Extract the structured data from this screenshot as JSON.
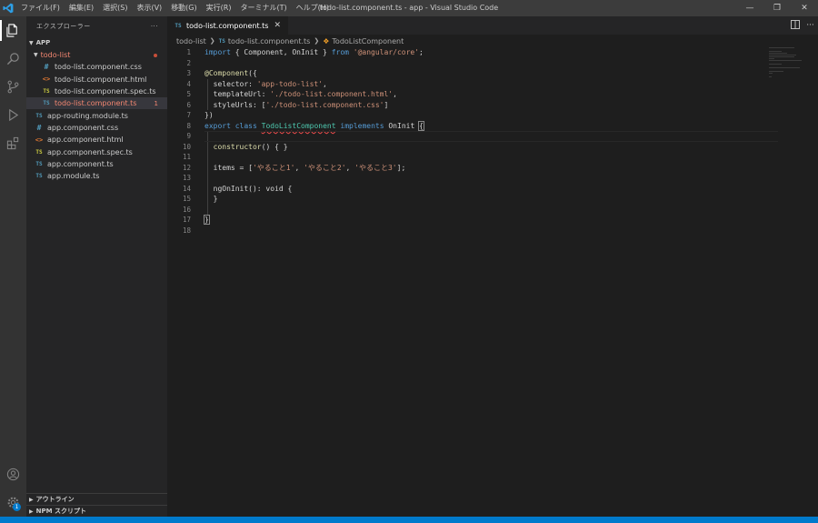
{
  "window": {
    "title": "todo-list.component.ts - app - Visual Studio Code",
    "controls": [
      "—",
      "❐",
      "✕"
    ]
  },
  "menu": [
    "ファイル(F)",
    "編集(E)",
    "選択(S)",
    "表示(V)",
    "移動(G)",
    "実行(R)",
    "ターミナル(T)",
    "ヘルプ(H)"
  ],
  "activity_bar": {
    "items": [
      {
        "icon": "explorer-icon",
        "active": true
      },
      {
        "icon": "search-icon",
        "active": false
      },
      {
        "icon": "source-control-icon",
        "active": false
      },
      {
        "icon": "run-debug-icon",
        "active": false
      },
      {
        "icon": "extensions-icon",
        "active": false
      }
    ],
    "bottom": [
      {
        "icon": "account-icon"
      },
      {
        "icon": "manage-gear-icon",
        "badge": "1"
      }
    ]
  },
  "sidebar": {
    "title": "エクスプローラー",
    "more": "···",
    "folder": "APP",
    "tree": [
      {
        "label": "todo-list",
        "type": "folder",
        "indent": 1,
        "error": true
      },
      {
        "label": "todo-list.component.css",
        "type": "css",
        "indent": 2
      },
      {
        "label": "todo-list.component.html",
        "type": "html",
        "indent": 2
      },
      {
        "label": "todo-list.component.spec.ts",
        "type": "spec",
        "indent": 2
      },
      {
        "label": "todo-list.component.ts",
        "type": "ts",
        "indent": 2,
        "selected": true,
        "error": true,
        "marker": "1"
      },
      {
        "label": "app-routing.module.ts",
        "type": "ts",
        "indent": 1
      },
      {
        "label": "app.component.css",
        "type": "css",
        "indent": 1
      },
      {
        "label": "app.component.html",
        "type": "html",
        "indent": 1
      },
      {
        "label": "app.component.spec.ts",
        "type": "spec",
        "indent": 1
      },
      {
        "label": "app.component.ts",
        "type": "ts",
        "indent": 1
      },
      {
        "label": "app.module.ts",
        "type": "ts",
        "indent": 1
      }
    ],
    "outline": "アウトライン",
    "npm": "NPM スクリプト"
  },
  "editor": {
    "tab": {
      "icon": "TS",
      "label": "todo-list.component.ts",
      "close": "✕"
    },
    "breadcrumb": {
      "folder": "todo-list",
      "file_icon": "TS",
      "file": "todo-list.component.ts",
      "symbol": "TodoListComponent"
    },
    "lines": [
      [
        [
          "kw",
          "import"
        ],
        [
          "pl",
          " { Component, OnInit } "
        ],
        [
          "kw",
          "from"
        ],
        [
          "pl",
          " "
        ],
        [
          "str",
          "'@angular/core'"
        ],
        [
          "pl",
          ";"
        ]
      ],
      [],
      [
        [
          "dec",
          "@Component"
        ],
        [
          "pl",
          "({"
        ]
      ],
      [
        [
          "pl",
          "  selector: "
        ],
        [
          "str",
          "'app-todo-list'"
        ],
        [
          "pl",
          ","
        ]
      ],
      [
        [
          "pl",
          "  templateUrl: "
        ],
        [
          "str",
          "'./todo-list.component.html'"
        ],
        [
          "pl",
          ","
        ]
      ],
      [
        [
          "pl",
          "  styleUrls: ["
        ],
        [
          "str",
          "'./todo-list.component.css'"
        ],
        [
          "pl",
          "]"
        ]
      ],
      [
        [
          "pl",
          "})"
        ]
      ],
      [
        [
          "kw",
          "export"
        ],
        [
          "pl",
          " "
        ],
        [
          "kw",
          "class"
        ],
        [
          "pl",
          " "
        ],
        [
          "squig",
          "TodoListComponent"
        ],
        [
          "pl",
          " "
        ],
        [
          "kw",
          "implements"
        ],
        [
          "pl",
          " OnInit "
        ],
        [
          "brace",
          "{"
        ]
      ],
      [],
      [
        [
          "pl",
          "  "
        ],
        [
          "dec",
          "constructor"
        ],
        [
          "pl",
          "() { }"
        ]
      ],
      [],
      [
        [
          "pl",
          "  items = ["
        ],
        [
          "str",
          "'やること1'"
        ],
        [
          "pl",
          ", "
        ],
        [
          "str",
          "'やること2'"
        ],
        [
          "pl",
          ", "
        ],
        [
          "str",
          "'やること3'"
        ],
        [
          "pl",
          "];"
        ]
      ],
      [],
      [
        [
          "pl",
          "  ngOnInit(): void {"
        ]
      ],
      [
        [
          "pl",
          "  }"
        ]
      ],
      [],
      [
        [
          "brace",
          "}"
        ]
      ],
      []
    ]
  }
}
